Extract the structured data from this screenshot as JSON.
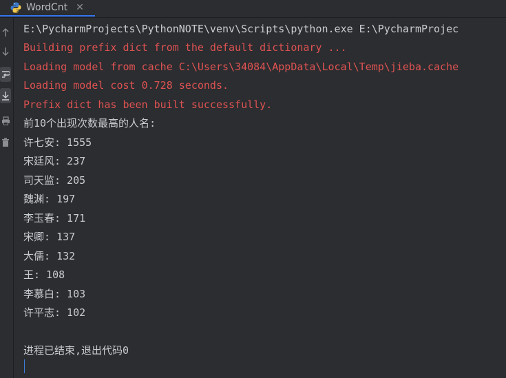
{
  "tab": {
    "label": "WordCnt",
    "close_glyph": "✕",
    "icon": "python-icon"
  },
  "toolstrip": {
    "buttons": [
      "up-arrow-icon",
      "down-arrow-icon",
      "soft-wrap-icon",
      "scroll-to-end-icon",
      "print-icon",
      "trash-icon"
    ]
  },
  "console": {
    "command": "E:\\PycharmProjects\\PythonNOTE\\venv\\Scripts\\python.exe E:\\PycharmProjec",
    "stderr": [
      "Building prefix dict from the default dictionary ...",
      "Loading model from cache C:\\Users\\34084\\AppData\\Local\\Temp\\jieba.cache",
      "Loading model cost 0.728 seconds.",
      "Prefix dict has been built successfully."
    ],
    "header": "前10个出现次数最高的人名:",
    "results": [
      "许七安: 1555",
      "宋廷风: 237",
      "司天监: 205",
      "魏渊: 197",
      "李玉春: 171",
      "宋卿: 137",
      "大儒: 132",
      "王: 108",
      "李慕白: 103",
      "许平志: 102"
    ],
    "exit_message": "进程已结束,退出代码0"
  },
  "colors": {
    "background": "#2b2d30",
    "stdout": "#c9ccd1",
    "stderr": "#e05252",
    "accent": "#3574f0"
  }
}
